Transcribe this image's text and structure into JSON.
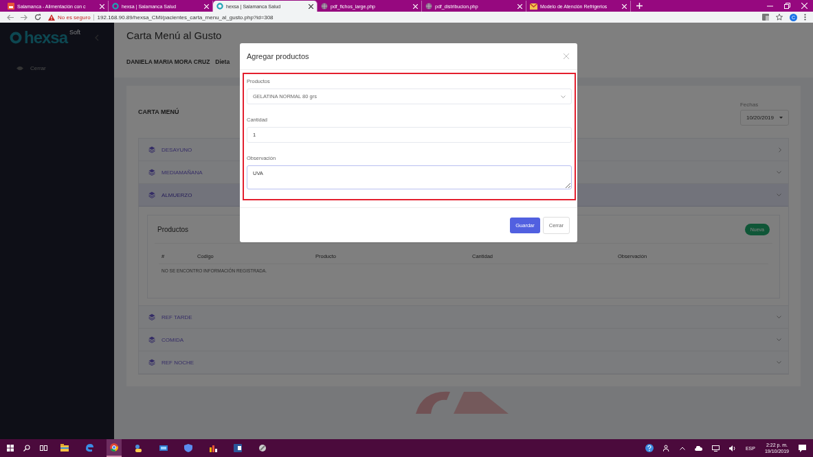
{
  "browser": {
    "tabs": [
      {
        "title": "Salamanca - Alimentación con c",
        "kind": "app",
        "selected": false
      },
      {
        "title": "hexsa | Salamanca Salud",
        "kind": "ring",
        "selected": false
      },
      {
        "title": "hexsa | Salamanca Salud",
        "kind": "ring",
        "selected": true
      },
      {
        "title": "pdf_fichos_large.php",
        "kind": "globe",
        "selected": false
      },
      {
        "title": "pdf_distribucion.php",
        "kind": "globe",
        "selected": false
      },
      {
        "title": "Modelo de Atención Refrigerios",
        "kind": "mail",
        "selected": false
      }
    ],
    "security": "No es seguro",
    "url": "192.168.90.89/hexsa_CMI/pacientes_carta_menu_al_gusto.php?id=308",
    "avatar": "C"
  },
  "sidebar": {
    "logo": "hexsa",
    "logo_suffix": "Soft",
    "items": [
      {
        "label": "Cerrar"
      }
    ]
  },
  "page": {
    "title": "Carta Menú al Gusto",
    "patient": "DANIELA MARIA MORA CRUZ",
    "diet": "Dieta"
  },
  "card": {
    "title": "CARTA MENÚ",
    "date_label": "Fechas",
    "date": "10/20/2019",
    "meals": [
      {
        "label": "DESAYUNO",
        "expanded": false,
        "kind": "right"
      },
      {
        "label": "MEDIAMAÑANA",
        "expanded": false,
        "kind": "down"
      },
      {
        "label": "ALMUERZO",
        "expanded": true,
        "kind": "down"
      },
      {
        "label": "REF TARDE",
        "expanded": false,
        "kind": "down"
      },
      {
        "label": "COMIDA",
        "expanded": false,
        "kind": "down"
      },
      {
        "label": "REF NOCHE",
        "expanded": false,
        "kind": "down"
      }
    ],
    "panel": {
      "title": "Productos",
      "button": "Nueva",
      "columns": [
        "#",
        "Codigo",
        "Producto",
        "Cantidad",
        "Observación"
      ],
      "empty": "NO SE ENCONTRO INFORMACIÓN REGISTRADA."
    }
  },
  "modal": {
    "title": "Agregar productos",
    "fields": [
      {
        "label": "Productos",
        "kind": "select",
        "value": "GELATINA NORMAL 80 grs"
      },
      {
        "label": "Cantidad",
        "kind": "input",
        "value": "1"
      },
      {
        "label": "Observación",
        "kind": "textarea",
        "value": "UVA"
      }
    ],
    "buttons": [
      {
        "label": "Guardar",
        "kind": "primary"
      },
      {
        "label": "Cerrar",
        "kind": "secondary"
      }
    ]
  },
  "taskbar": {
    "apps": [
      {
        "kind": "explorer",
        "selected": false
      },
      {
        "kind": "edge",
        "selected": false
      },
      {
        "kind": "chrome",
        "selected": true
      },
      {
        "kind": "people",
        "selected": false
      },
      {
        "kind": "mail",
        "selected": false
      },
      {
        "kind": "shield",
        "selected": false
      },
      {
        "kind": "chart",
        "selected": false
      },
      {
        "kind": "word",
        "selected": false
      },
      {
        "kind": "tool",
        "selected": false
      }
    ],
    "language": "ESP",
    "time": "2:22 p. m.",
    "date": "19/10/2019"
  }
}
